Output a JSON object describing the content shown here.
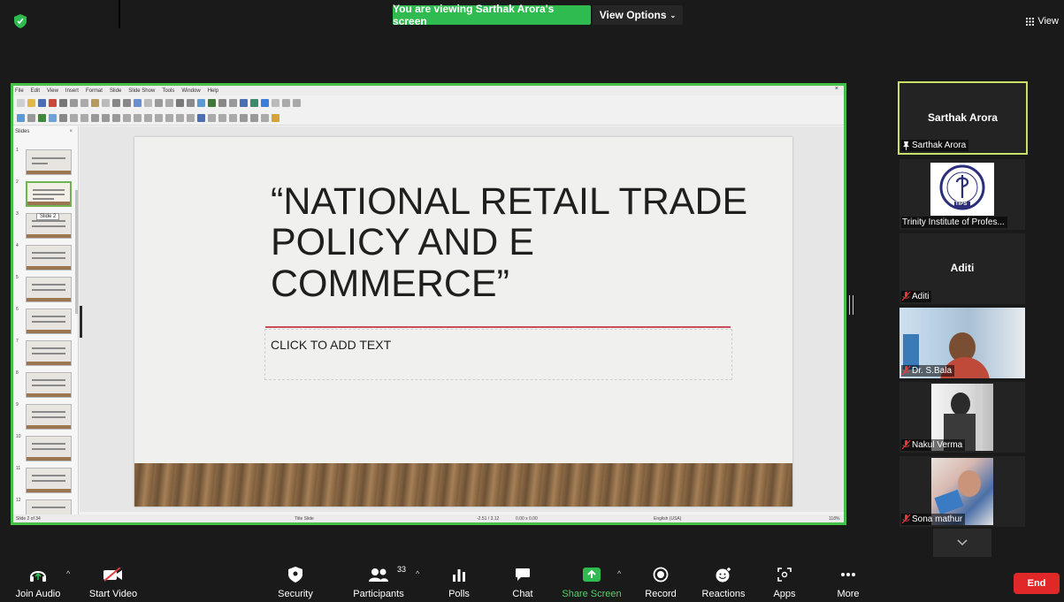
{
  "meeting": {
    "banner": "You are viewing Sarthak Arora's screen",
    "view_options": "View Options",
    "view_toggle": "View",
    "colors": {
      "banner_green": "#2fbb4f",
      "end_red": "#e02828",
      "active_border": "#c8e06a"
    }
  },
  "presentation": {
    "menu": [
      "File",
      "Edit",
      "View",
      "Insert",
      "Format",
      "Slide",
      "Slide Show",
      "Tools",
      "Window",
      "Help"
    ],
    "pane_title": "Slides",
    "thumb_numbers": [
      "1",
      "2",
      "3",
      "4",
      "5",
      "6",
      "7",
      "8",
      "9",
      "10",
      "11",
      "12"
    ],
    "thumb_tooltip": "Slide 2",
    "slide_title": "“NATIONAL RETAIL TRADE POLICY AND E COMMERCE”",
    "slide_subtitle": "CLICK TO ADD TEXT",
    "status": {
      "slide_count": "Slide 2 of 34",
      "layout": "Title Slide",
      "position": "-2.51 / 3.12",
      "size": "0.00 x 0.00",
      "language": "English (USA)",
      "zoom": "118%"
    }
  },
  "participants": [
    {
      "center_name": "Sarthak Arora",
      "label": "Sarthak Arora",
      "state": "active-speaker"
    },
    {
      "label": "Trinity Institute of Profes...",
      "logo_text": "TIPS"
    },
    {
      "center_name": "Aditi",
      "label": "Aditi",
      "muted": true
    },
    {
      "label": "Dr. S.Bala",
      "muted": true
    },
    {
      "label": "Nakul Verma",
      "muted": true
    },
    {
      "label": "Sona mathur",
      "muted": true
    }
  ],
  "toolbar": {
    "join_audio": "Join Audio",
    "start_video": "Start Video",
    "security": "Security",
    "participants": "Participants",
    "participants_count": "33",
    "polls": "Polls",
    "chat": "Chat",
    "share_screen": "Share Screen",
    "record": "Record",
    "reactions": "Reactions",
    "apps": "Apps",
    "more": "More",
    "end": "End"
  }
}
